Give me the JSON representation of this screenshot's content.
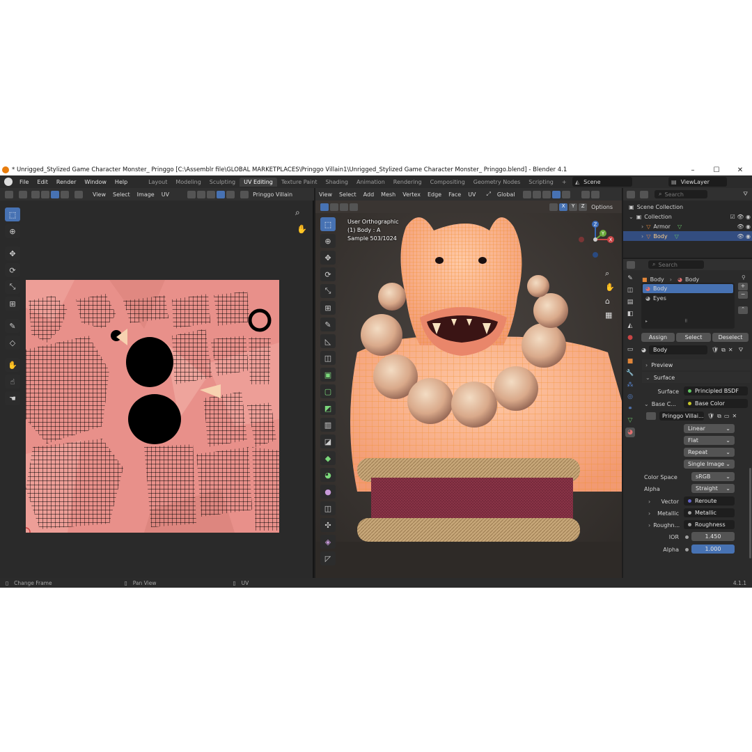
{
  "window": {
    "title": "* Unrigged_Stylized Game Character Monster_ Pringgo [C:\\Assemblr file\\GLOBAL MARKETPLACES\\Pringgo Villain1\\Unrigged_Stylized Game Character Monster_ Pringgo.blend] - Blender 4.1",
    "minimize": "–",
    "maximize": "☐",
    "close": "✕"
  },
  "menu": [
    "File",
    "Edit",
    "Render",
    "Window",
    "Help"
  ],
  "workspaces": [
    "Layout",
    "Modeling",
    "Sculpting",
    "UV Editing",
    "Texture Paint",
    "Shading",
    "Animation",
    "Rendering",
    "Compositing",
    "Geometry Nodes",
    "Scripting",
    "+"
  ],
  "active_workspace": "UV Editing",
  "scene": "Scene",
  "view_layer": "ViewLayer",
  "uv_editor": {
    "menus": [
      "View",
      "Select",
      "Image",
      "UV"
    ],
    "image_name": "Pringgo Villain"
  },
  "viewport": {
    "menus": [
      "View",
      "Select",
      "Add",
      "Mesh",
      "Vertex",
      "Edge",
      "Face",
      "UV"
    ],
    "orientation": "Global",
    "options": "Options",
    "axes": [
      "X",
      "Y",
      "Z"
    ],
    "overlay_lines": [
      "User Orthographic",
      "(1) Body : A",
      "Sample 503/1024"
    ],
    "gizmo": {
      "x": "X",
      "y": "Y",
      "z": "Z"
    }
  },
  "outliner": {
    "search_placeholder": "Search",
    "rows": [
      "Scene Collection",
      "Collection",
      "Armor",
      "Body"
    ]
  },
  "properties": {
    "search_placeholder": "Search",
    "breadcrumb": [
      "Body",
      "Body"
    ],
    "material_slots": [
      "Body",
      "Eyes"
    ],
    "buttons": {
      "assign": "Assign",
      "select": "Select",
      "deselect": "Deselect"
    },
    "material_name": "Body",
    "sections": {
      "preview": "Preview",
      "surface": "Surface"
    },
    "surface_label": "Surface",
    "surface_value": "Principled BSDF",
    "base_color_label": "Base C...",
    "base_color_value": "Base Color",
    "image_name": "Pringgo Villai...",
    "interpolation": "Linear",
    "projection": "Flat",
    "extension": "Repeat",
    "source": "Single Image",
    "color_space_label": "Color Space",
    "color_space": "sRGB",
    "alpha_label": "Alpha",
    "alpha_mode": "Straight",
    "inputs": [
      {
        "label": "Vector",
        "value": "Reroute"
      },
      {
        "label": "Metallic",
        "value": "Metallic"
      },
      {
        "label": "Roughn...",
        "value": "Roughness"
      }
    ],
    "ior_label": "IOR",
    "ior": "1.450",
    "alpha_value_label": "Alpha",
    "alpha_value": "1.000"
  },
  "status": {
    "left": "Change Frame",
    "middle": "Pan View",
    "right": "UV",
    "version": "4.1.1"
  },
  "colors": {
    "accent": "#4772b3",
    "uv_bg": "#e8908a",
    "skin": "#f5b08c",
    "wire": "#f09a30"
  }
}
